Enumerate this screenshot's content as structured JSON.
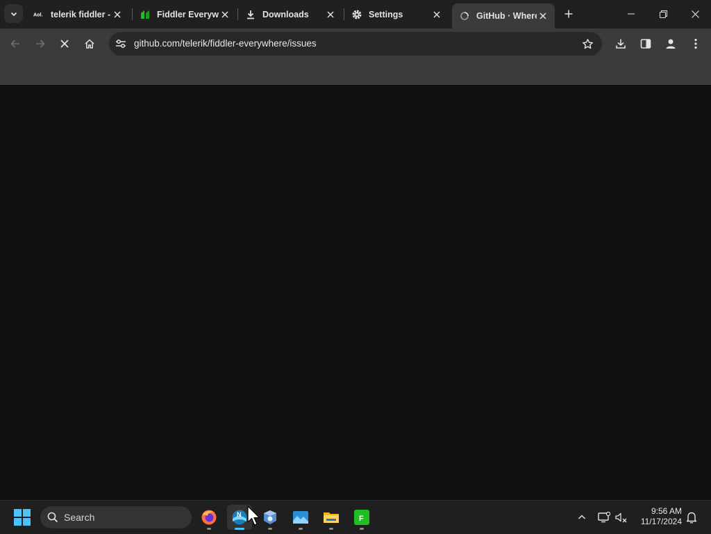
{
  "tabs": [
    {
      "title": "telerik fiddler -",
      "favicon": "aol-icon"
    },
    {
      "title": "Fiddler Everywhe",
      "favicon": "fiddler-icon"
    },
    {
      "title": "Downloads",
      "favicon": "download-icon"
    },
    {
      "title": "Settings",
      "favicon": "gear-icon"
    },
    {
      "title": "GitHub · Where",
      "favicon": "github-loading-icon",
      "active": true
    }
  ],
  "omnibox": {
    "url": "github.com/telerik/fiddler-everywhere/issues"
  },
  "taskbar": {
    "search_label": "Search",
    "apps": [
      "firefox",
      "netsurf",
      "vpn-app",
      "photos",
      "file-explorer",
      "fiddler"
    ],
    "time": "9:56 AM",
    "date": "11/17/2024"
  },
  "colors": {
    "accent": "#4cc2ff",
    "background": "#111111",
    "toolbar": "#3b3b3b",
    "fiddler_green": "#1fbf1f"
  }
}
